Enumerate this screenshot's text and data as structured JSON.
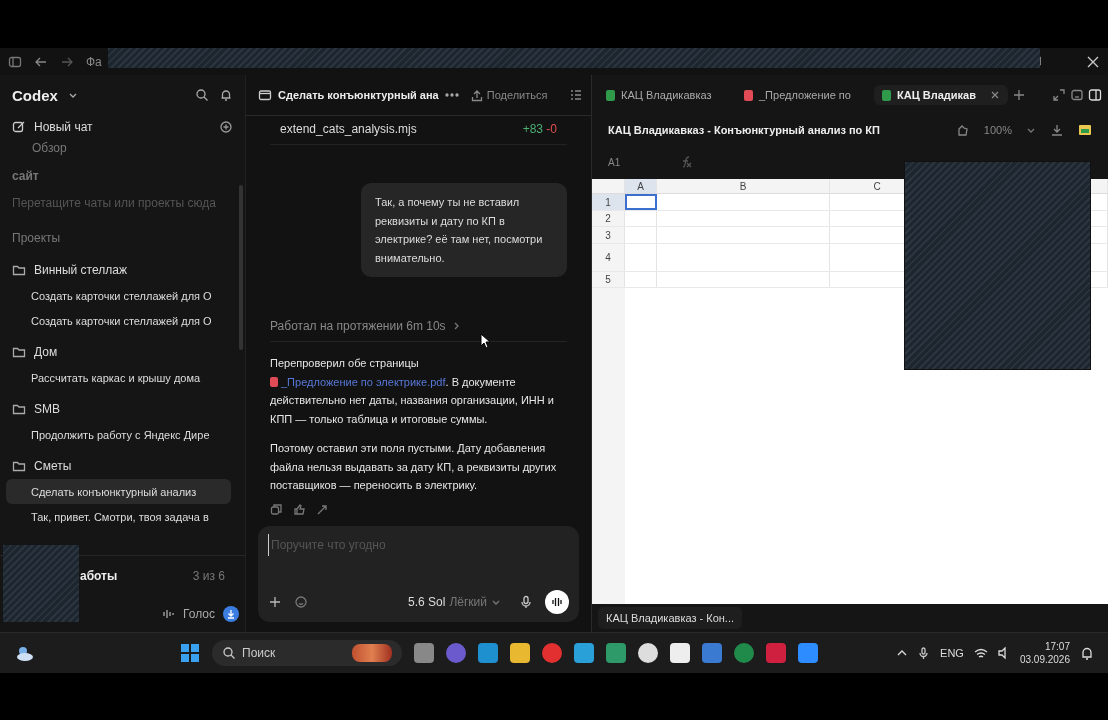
{
  "titlebar": {
    "menu_text": "Фа"
  },
  "sidebar": {
    "brand": "Codex",
    "new_chat": "Новый чат",
    "overview": "Обзор",
    "pinned": {
      "title": "сайт",
      "hint": "Перетащите чаты или проекты сюда"
    },
    "projects_title": "Проекты",
    "projects": [
      {
        "name": "Винный стеллаж",
        "chats": [
          {
            "title": "Создать карточки стеллажей для О",
            "selected": false
          },
          {
            "title": "Создать карточки стеллажей для О",
            "selected": false
          }
        ]
      },
      {
        "name": "Дом",
        "chats": [
          {
            "title": "Рассчитать каркас и крышу дома",
            "selected": false
          }
        ]
      },
      {
        "name": "SMB",
        "chats": [
          {
            "title": "Продолжить работу с Яндекс Дире",
            "selected": false
          }
        ]
      },
      {
        "name": "Сметы",
        "chats": [
          {
            "title": "Сделать конъюнктурный анализ",
            "selected": true
          },
          {
            "title": "Так, привет. Смотри, твоя задача в",
            "selected": false
          }
        ]
      }
    ],
    "task": {
      "label": "аботы",
      "count": "3 из 6"
    },
    "voice": "Голос"
  },
  "chat": {
    "title": "Сделать конъюнктурный ана",
    "share": "Поделиться",
    "file": {
      "name": "extend_cats_analysis.mjs",
      "added": "+83",
      "removed": "-0"
    },
    "user_message": "Так, а почему ты не вставил реквизиты и дату по КП в электрике? её там нет, посмотри внимательно.",
    "worked": "Работал на протяжении 6m 10s",
    "reply": {
      "before": "Перепроверил обе страницы",
      "link": "_Предложение по электрике.pdf",
      "after": ". В документе действительно нет даты, названия организации, ИНН и КПП — только таблица и итоговые суммы."
    },
    "reply_2": "Поэтому оставил эти поля пустыми. Дату добавления файла нельзя выдавать за дату КП, а реквизиты других поставщиков — переносить в электрику.",
    "composer": {
      "placeholder": "Поручите что угодно",
      "model": "5.6 Sol",
      "effort": "Лёгкий"
    }
  },
  "viewer": {
    "tabs": [
      {
        "label": "КАЦ Владикавказ",
        "kind": "sheet",
        "selected": false
      },
      {
        "label": "_Предложение по",
        "kind": "pdf",
        "selected": false
      },
      {
        "label": "КАЦ Владикав",
        "kind": "sheet",
        "selected": true
      }
    ],
    "doc_title": "КАЦ Владикавказ - Конъюнктурный анализ по КП",
    "zoom": "100%",
    "cell_ref": "A1",
    "columns": [
      {
        "label": "A",
        "selected": true
      },
      {
        "label": "B",
        "selected": false
      },
      {
        "label": "C",
        "selected": false
      }
    ],
    "rows": [
      {
        "label": "1",
        "selected": true
      },
      {
        "label": "2",
        "selected": false
      },
      {
        "label": "3",
        "selected": false
      },
      {
        "label": "4",
        "selected": false
      },
      {
        "label": "5",
        "selected": false
      }
    ],
    "window_tab": "КАЦ Владикавказ - Кон..."
  },
  "taskbar": {
    "search": "Поиск",
    "language": "ENG",
    "time": "17:07",
    "date": "03.09.2026"
  }
}
